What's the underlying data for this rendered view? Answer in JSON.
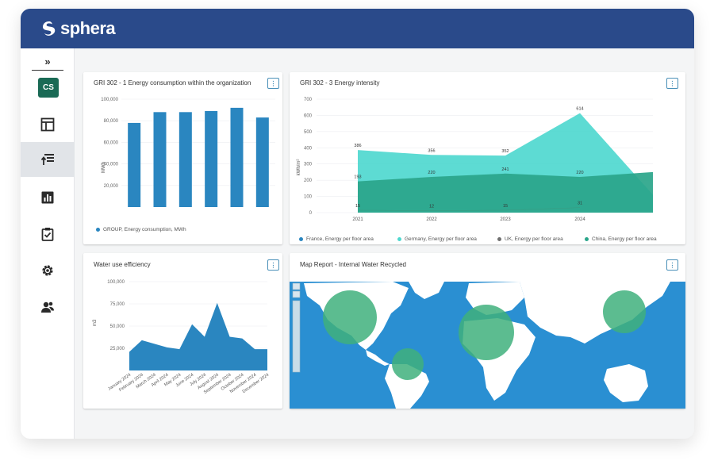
{
  "app": {
    "logo_text": "sphera"
  },
  "sidebar": {
    "expand_glyph": "»",
    "avatar_initials": "CS",
    "items": [
      {
        "name": "dashboard-layout-icon",
        "active": false
      },
      {
        "name": "data-upload-icon",
        "active": true
      },
      {
        "name": "bar-chart-icon",
        "active": false
      },
      {
        "name": "clipboard-check-icon",
        "active": false
      },
      {
        "name": "gear-icon",
        "active": false
      },
      {
        "name": "users-icon",
        "active": false
      }
    ]
  },
  "cards": {
    "energy": {
      "title": "GRI 302 - 1 Energy consumption within the organization",
      "menu": "⋮"
    },
    "intensity": {
      "title": "GRI 302 - 3 Energy intensity",
      "menu": "⋮"
    },
    "water": {
      "title": "Water use efficiency",
      "menu": "⋮"
    },
    "map": {
      "title": "Map Report - Internal Water Recycled",
      "menu": "⋮"
    }
  },
  "colors": {
    "header": "#2a4a8a",
    "bar": "#2a86c0",
    "france": "#2a86c0",
    "germany": "#4fd8cf",
    "uk": "#707070",
    "china": "#2aa58a",
    "ocean": "#2a8fd2",
    "bubble": "#3fb07c"
  },
  "chart_data": [
    {
      "type": "bar",
      "ylabel": "MWh",
      "ylim": [
        0,
        100000
      ],
      "yticks": [
        "100,000",
        "80,000",
        "60,000",
        "40,000",
        "20,000"
      ],
      "values": [
        78000,
        88000,
        88000,
        89000,
        92000,
        83000
      ],
      "series": [
        {
          "name": "GROUP, Energy consumption, MWh",
          "values": [
            78000,
            88000,
            88000,
            89000,
            92000,
            83000
          ]
        }
      ]
    },
    {
      "type": "area",
      "ylabel": "kWh/m²",
      "ylim": [
        0,
        700
      ],
      "yticks": [
        "700",
        "600",
        "500",
        "400",
        "300",
        "200",
        "100",
        "0"
      ],
      "categories": [
        "2021",
        "2022",
        "2023",
        "2024"
      ],
      "series": [
        {
          "name": "France, Energy per floor area",
          "values": [
            null,
            null,
            null,
            null
          ]
        },
        {
          "name": "Germany, Energy per floor area",
          "values": [
            386,
            356,
            352,
            614
          ],
          "labels": [
            "386",
            "356",
            "352",
            "614"
          ]
        },
        {
          "name": "UK, Energy per floor area",
          "values": [
            null,
            null,
            null,
            null
          ]
        },
        {
          "name": "China, Energy per floor area",
          "values": [
            193,
            220,
            241,
            220
          ],
          "labels": [
            "193",
            "220",
            "241",
            "220"
          ]
        },
        {
          "name": "",
          "values": [
            15,
            12,
            15,
            31
          ],
          "labels": [
            "15",
            "12",
            "15",
            "31"
          ]
        }
      ]
    },
    {
      "type": "area",
      "ylabel": "m3",
      "ylim": [
        0,
        100000
      ],
      "yticks": [
        "100,000",
        "75,000",
        "50,000",
        "25,000"
      ],
      "categories": [
        "January 2024",
        "February 2024",
        "March 2024",
        "April 2024",
        "May 2024",
        "June 2024",
        "July 2024",
        "August 2024",
        "September 2024",
        "October 2024",
        "November 2024",
        "December 2024"
      ],
      "values": [
        21000,
        34000,
        30000,
        26000,
        24000,
        52000,
        38000,
        76000,
        38000,
        36000,
        24000,
        24000
      ]
    }
  ]
}
